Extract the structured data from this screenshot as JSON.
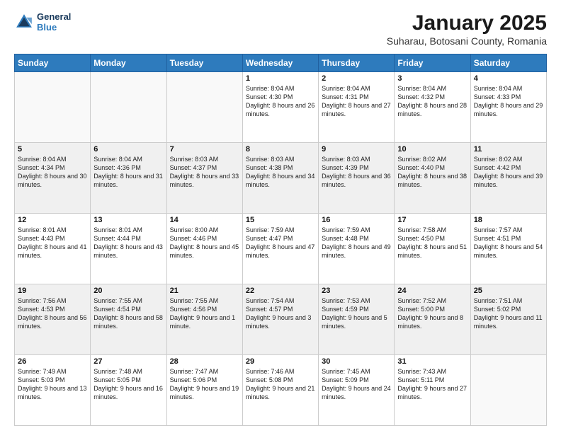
{
  "logo": {
    "line1": "General",
    "line2": "Blue"
  },
  "title": "January 2025",
  "subtitle": "Suharau, Botosani County, Romania",
  "weekdays": [
    "Sunday",
    "Monday",
    "Tuesday",
    "Wednesday",
    "Thursday",
    "Friday",
    "Saturday"
  ],
  "weeks": [
    [
      {
        "day": "",
        "info": ""
      },
      {
        "day": "",
        "info": ""
      },
      {
        "day": "",
        "info": ""
      },
      {
        "day": "1",
        "info": "Sunrise: 8:04 AM\nSunset: 4:30 PM\nDaylight: 8 hours and 26 minutes."
      },
      {
        "day": "2",
        "info": "Sunrise: 8:04 AM\nSunset: 4:31 PM\nDaylight: 8 hours and 27 minutes."
      },
      {
        "day": "3",
        "info": "Sunrise: 8:04 AM\nSunset: 4:32 PM\nDaylight: 8 hours and 28 minutes."
      },
      {
        "day": "4",
        "info": "Sunrise: 8:04 AM\nSunset: 4:33 PM\nDaylight: 8 hours and 29 minutes."
      }
    ],
    [
      {
        "day": "5",
        "info": "Sunrise: 8:04 AM\nSunset: 4:34 PM\nDaylight: 8 hours and 30 minutes."
      },
      {
        "day": "6",
        "info": "Sunrise: 8:04 AM\nSunset: 4:36 PM\nDaylight: 8 hours and 31 minutes."
      },
      {
        "day": "7",
        "info": "Sunrise: 8:03 AM\nSunset: 4:37 PM\nDaylight: 8 hours and 33 minutes."
      },
      {
        "day": "8",
        "info": "Sunrise: 8:03 AM\nSunset: 4:38 PM\nDaylight: 8 hours and 34 minutes."
      },
      {
        "day": "9",
        "info": "Sunrise: 8:03 AM\nSunset: 4:39 PM\nDaylight: 8 hours and 36 minutes."
      },
      {
        "day": "10",
        "info": "Sunrise: 8:02 AM\nSunset: 4:40 PM\nDaylight: 8 hours and 38 minutes."
      },
      {
        "day": "11",
        "info": "Sunrise: 8:02 AM\nSunset: 4:42 PM\nDaylight: 8 hours and 39 minutes."
      }
    ],
    [
      {
        "day": "12",
        "info": "Sunrise: 8:01 AM\nSunset: 4:43 PM\nDaylight: 8 hours and 41 minutes."
      },
      {
        "day": "13",
        "info": "Sunrise: 8:01 AM\nSunset: 4:44 PM\nDaylight: 8 hours and 43 minutes."
      },
      {
        "day": "14",
        "info": "Sunrise: 8:00 AM\nSunset: 4:46 PM\nDaylight: 8 hours and 45 minutes."
      },
      {
        "day": "15",
        "info": "Sunrise: 7:59 AM\nSunset: 4:47 PM\nDaylight: 8 hours and 47 minutes."
      },
      {
        "day": "16",
        "info": "Sunrise: 7:59 AM\nSunset: 4:48 PM\nDaylight: 8 hours and 49 minutes."
      },
      {
        "day": "17",
        "info": "Sunrise: 7:58 AM\nSunset: 4:50 PM\nDaylight: 8 hours and 51 minutes."
      },
      {
        "day": "18",
        "info": "Sunrise: 7:57 AM\nSunset: 4:51 PM\nDaylight: 8 hours and 54 minutes."
      }
    ],
    [
      {
        "day": "19",
        "info": "Sunrise: 7:56 AM\nSunset: 4:53 PM\nDaylight: 8 hours and 56 minutes."
      },
      {
        "day": "20",
        "info": "Sunrise: 7:55 AM\nSunset: 4:54 PM\nDaylight: 8 hours and 58 minutes."
      },
      {
        "day": "21",
        "info": "Sunrise: 7:55 AM\nSunset: 4:56 PM\nDaylight: 9 hours and 1 minute."
      },
      {
        "day": "22",
        "info": "Sunrise: 7:54 AM\nSunset: 4:57 PM\nDaylight: 9 hours and 3 minutes."
      },
      {
        "day": "23",
        "info": "Sunrise: 7:53 AM\nSunset: 4:59 PM\nDaylight: 9 hours and 5 minutes."
      },
      {
        "day": "24",
        "info": "Sunrise: 7:52 AM\nSunset: 5:00 PM\nDaylight: 9 hours and 8 minutes."
      },
      {
        "day": "25",
        "info": "Sunrise: 7:51 AM\nSunset: 5:02 PM\nDaylight: 9 hours and 11 minutes."
      }
    ],
    [
      {
        "day": "26",
        "info": "Sunrise: 7:49 AM\nSunset: 5:03 PM\nDaylight: 9 hours and 13 minutes."
      },
      {
        "day": "27",
        "info": "Sunrise: 7:48 AM\nSunset: 5:05 PM\nDaylight: 9 hours and 16 minutes."
      },
      {
        "day": "28",
        "info": "Sunrise: 7:47 AM\nSunset: 5:06 PM\nDaylight: 9 hours and 19 minutes."
      },
      {
        "day": "29",
        "info": "Sunrise: 7:46 AM\nSunset: 5:08 PM\nDaylight: 9 hours and 21 minutes."
      },
      {
        "day": "30",
        "info": "Sunrise: 7:45 AM\nSunset: 5:09 PM\nDaylight: 9 hours and 24 minutes."
      },
      {
        "day": "31",
        "info": "Sunrise: 7:43 AM\nSunset: 5:11 PM\nDaylight: 9 hours and 27 minutes."
      },
      {
        "day": "",
        "info": ""
      }
    ]
  ]
}
